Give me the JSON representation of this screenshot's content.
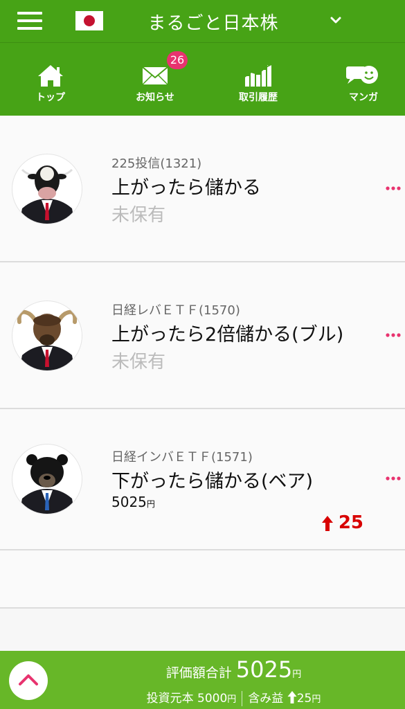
{
  "header": {
    "title": "まるごと日本株"
  },
  "tabs": [
    {
      "label": "トップ",
      "icon": "home-icon"
    },
    {
      "label": "お知らせ",
      "icon": "mail-icon",
      "badge": "26"
    },
    {
      "label": "取引履歴",
      "icon": "chart-icon"
    },
    {
      "label": "マンガ",
      "icon": "manga-icon"
    }
  ],
  "items": [
    {
      "code": "225投信(1321)",
      "name": "上がったら儲かる",
      "status": "未保有",
      "avatar": "cow-avatar"
    },
    {
      "code": "日経レバＥＴＦ(1570)",
      "name": "上がったら2倍儲かる(ブル)",
      "status": "未保有",
      "avatar": "bull-avatar"
    },
    {
      "code": "日経インバＥＴＦ(1571)",
      "name": "下がったら儲かる(ベア)",
      "price": "5025",
      "price_unit": "円",
      "change": "25",
      "avatar": "bear-avatar"
    }
  ],
  "footer": {
    "total_label": "評価額合計",
    "total_value": "5025",
    "unit": "円",
    "principal_label": "投資元本",
    "principal_value": "5000",
    "gain_label": "含み益",
    "gain_value": "25"
  },
  "colors": {
    "header_green": "#47a316",
    "footer_green": "#67b728",
    "badge_pink": "#e8336f",
    "more_pink": "#e8336f",
    "change_red": "#d80000"
  }
}
